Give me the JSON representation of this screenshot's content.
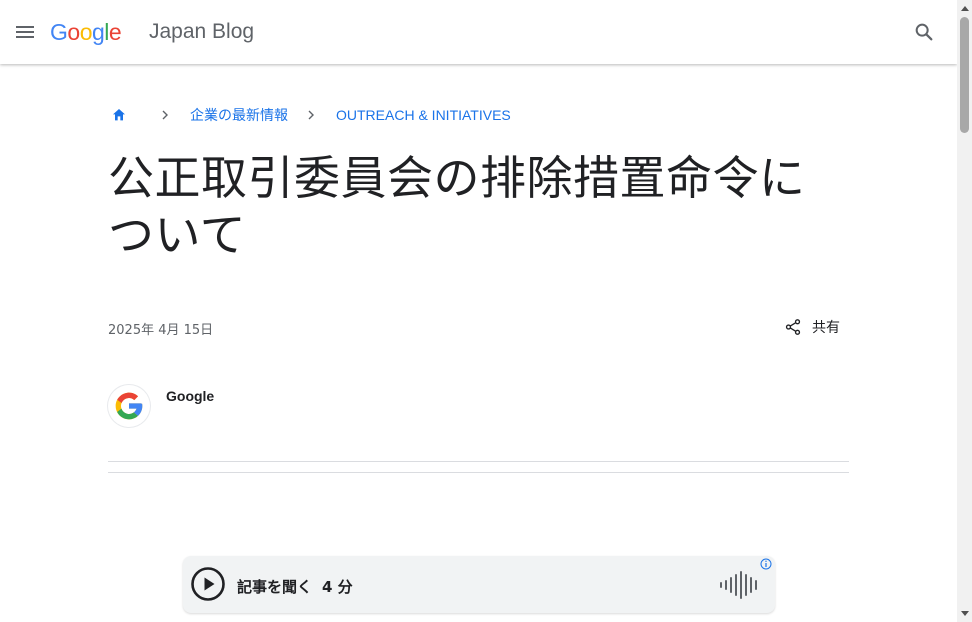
{
  "header": {
    "menu_icon": "hamburger-menu-icon",
    "logo_letters": [
      "G",
      "o",
      "o",
      "g",
      "l",
      "e"
    ],
    "blog_name": "Japan Blog",
    "search_icon": "search-icon"
  },
  "breadcrumb": {
    "home_icon": "home-icon",
    "items": [
      {
        "label": "企業の最新情報"
      },
      {
        "label": "OUTREACH & INITIATIVES"
      }
    ]
  },
  "article": {
    "title": "公正取引委員会の排除措置命令について",
    "date": "2025年 4月 15日",
    "share_label": "共有",
    "author": "Google"
  },
  "audio_player": {
    "label": "記事を聞く",
    "duration": "4 分"
  },
  "colors": {
    "link_blue": "#1a73e8",
    "google_blue": "#4285F4",
    "google_red": "#EA4335",
    "google_yellow": "#FBBC05",
    "google_green": "#34A853"
  }
}
